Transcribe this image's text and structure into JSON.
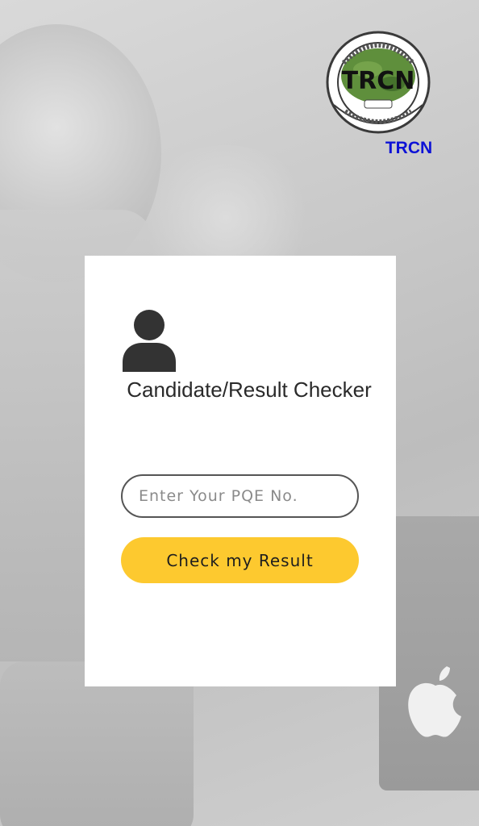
{
  "header": {
    "logo_icon": "trcn-logo",
    "logo_caption": "TRCN"
  },
  "card": {
    "icon": "user-icon",
    "title": " Candidate/Result Checker",
    "input": {
      "value": "",
      "placeholder": "Enter Your PQE No."
    },
    "submit_label": "Check my Result"
  },
  "colors": {
    "accent": "#fdc92f",
    "caption": "#0d12d6",
    "card_bg": "#ffffff"
  }
}
